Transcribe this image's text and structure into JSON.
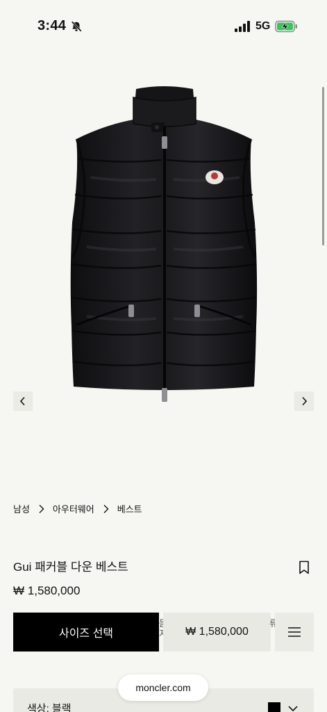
{
  "status_bar": {
    "time": "3:44",
    "network": "5G"
  },
  "product": {
    "image_alt": "Gui 패커블 다운 베스트",
    "name": "Gui 패커블 다운 베스트",
    "price": "₩ 1,580,000"
  },
  "breadcrumb": [
    "남성",
    "아우터웨어",
    "베스트"
  ],
  "action_bar": {
    "size_select_label": "사이즈 선택",
    "sticky_price": "₩ 1,580,000",
    "ghost_left": "듣\n지",
    "ghost_right": "류"
  },
  "color_selector": {
    "label": "색상: 블랙",
    "swatch_color": "#000000"
  },
  "browser": {
    "url": "moncler.com"
  },
  "colors": {
    "background": "#f6f6f2",
    "primary_button": "#000000",
    "secondary_surface": "#ebebe6"
  }
}
